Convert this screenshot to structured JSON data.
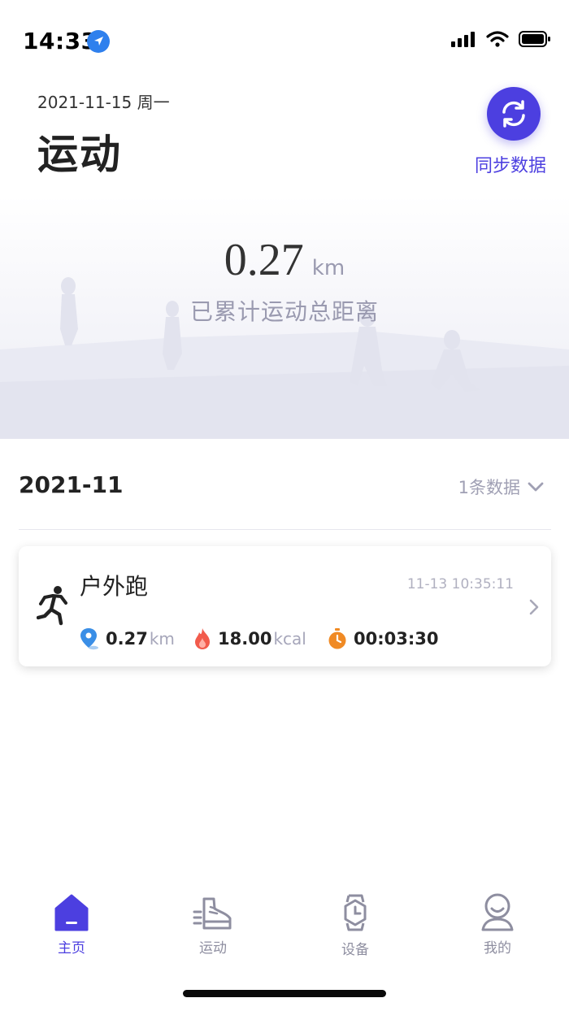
{
  "status_bar": {
    "time": "14:33",
    "icons": [
      "location-arrow-icon",
      "signal-icon",
      "wifi-icon",
      "battery-icon"
    ]
  },
  "header": {
    "date": "2021-11-15 周一",
    "title": "运动",
    "sync_label": "同步数据",
    "sync_icon": "sync-icon"
  },
  "summary": {
    "distance_value": "0.27",
    "distance_unit": "km",
    "caption": "已累计运动总距离"
  },
  "month_group": {
    "month": "2021-11",
    "count_label": "1条数据"
  },
  "records": [
    {
      "type": "户外跑",
      "icon": "runner-icon",
      "datetime": "11-13 10:35:11",
      "distance_value": "0.27",
      "distance_unit": "km",
      "calories_value": "18.00",
      "calories_unit": "kcal",
      "duration": "00:03:30"
    }
  ],
  "tabs": [
    {
      "label": "主页",
      "icon": "home-icon",
      "active": true
    },
    {
      "label": "运动",
      "icon": "shoe-icon",
      "active": false
    },
    {
      "label": "设备",
      "icon": "watch-icon",
      "active": false
    },
    {
      "label": "我的",
      "icon": "user-icon",
      "active": false
    }
  ],
  "colors": {
    "accent": "#4c3fe0",
    "muted": "#9a9ab0",
    "pin": "#3a8ee6",
    "flame": "#f25b4c",
    "timer": "#f08a24"
  }
}
